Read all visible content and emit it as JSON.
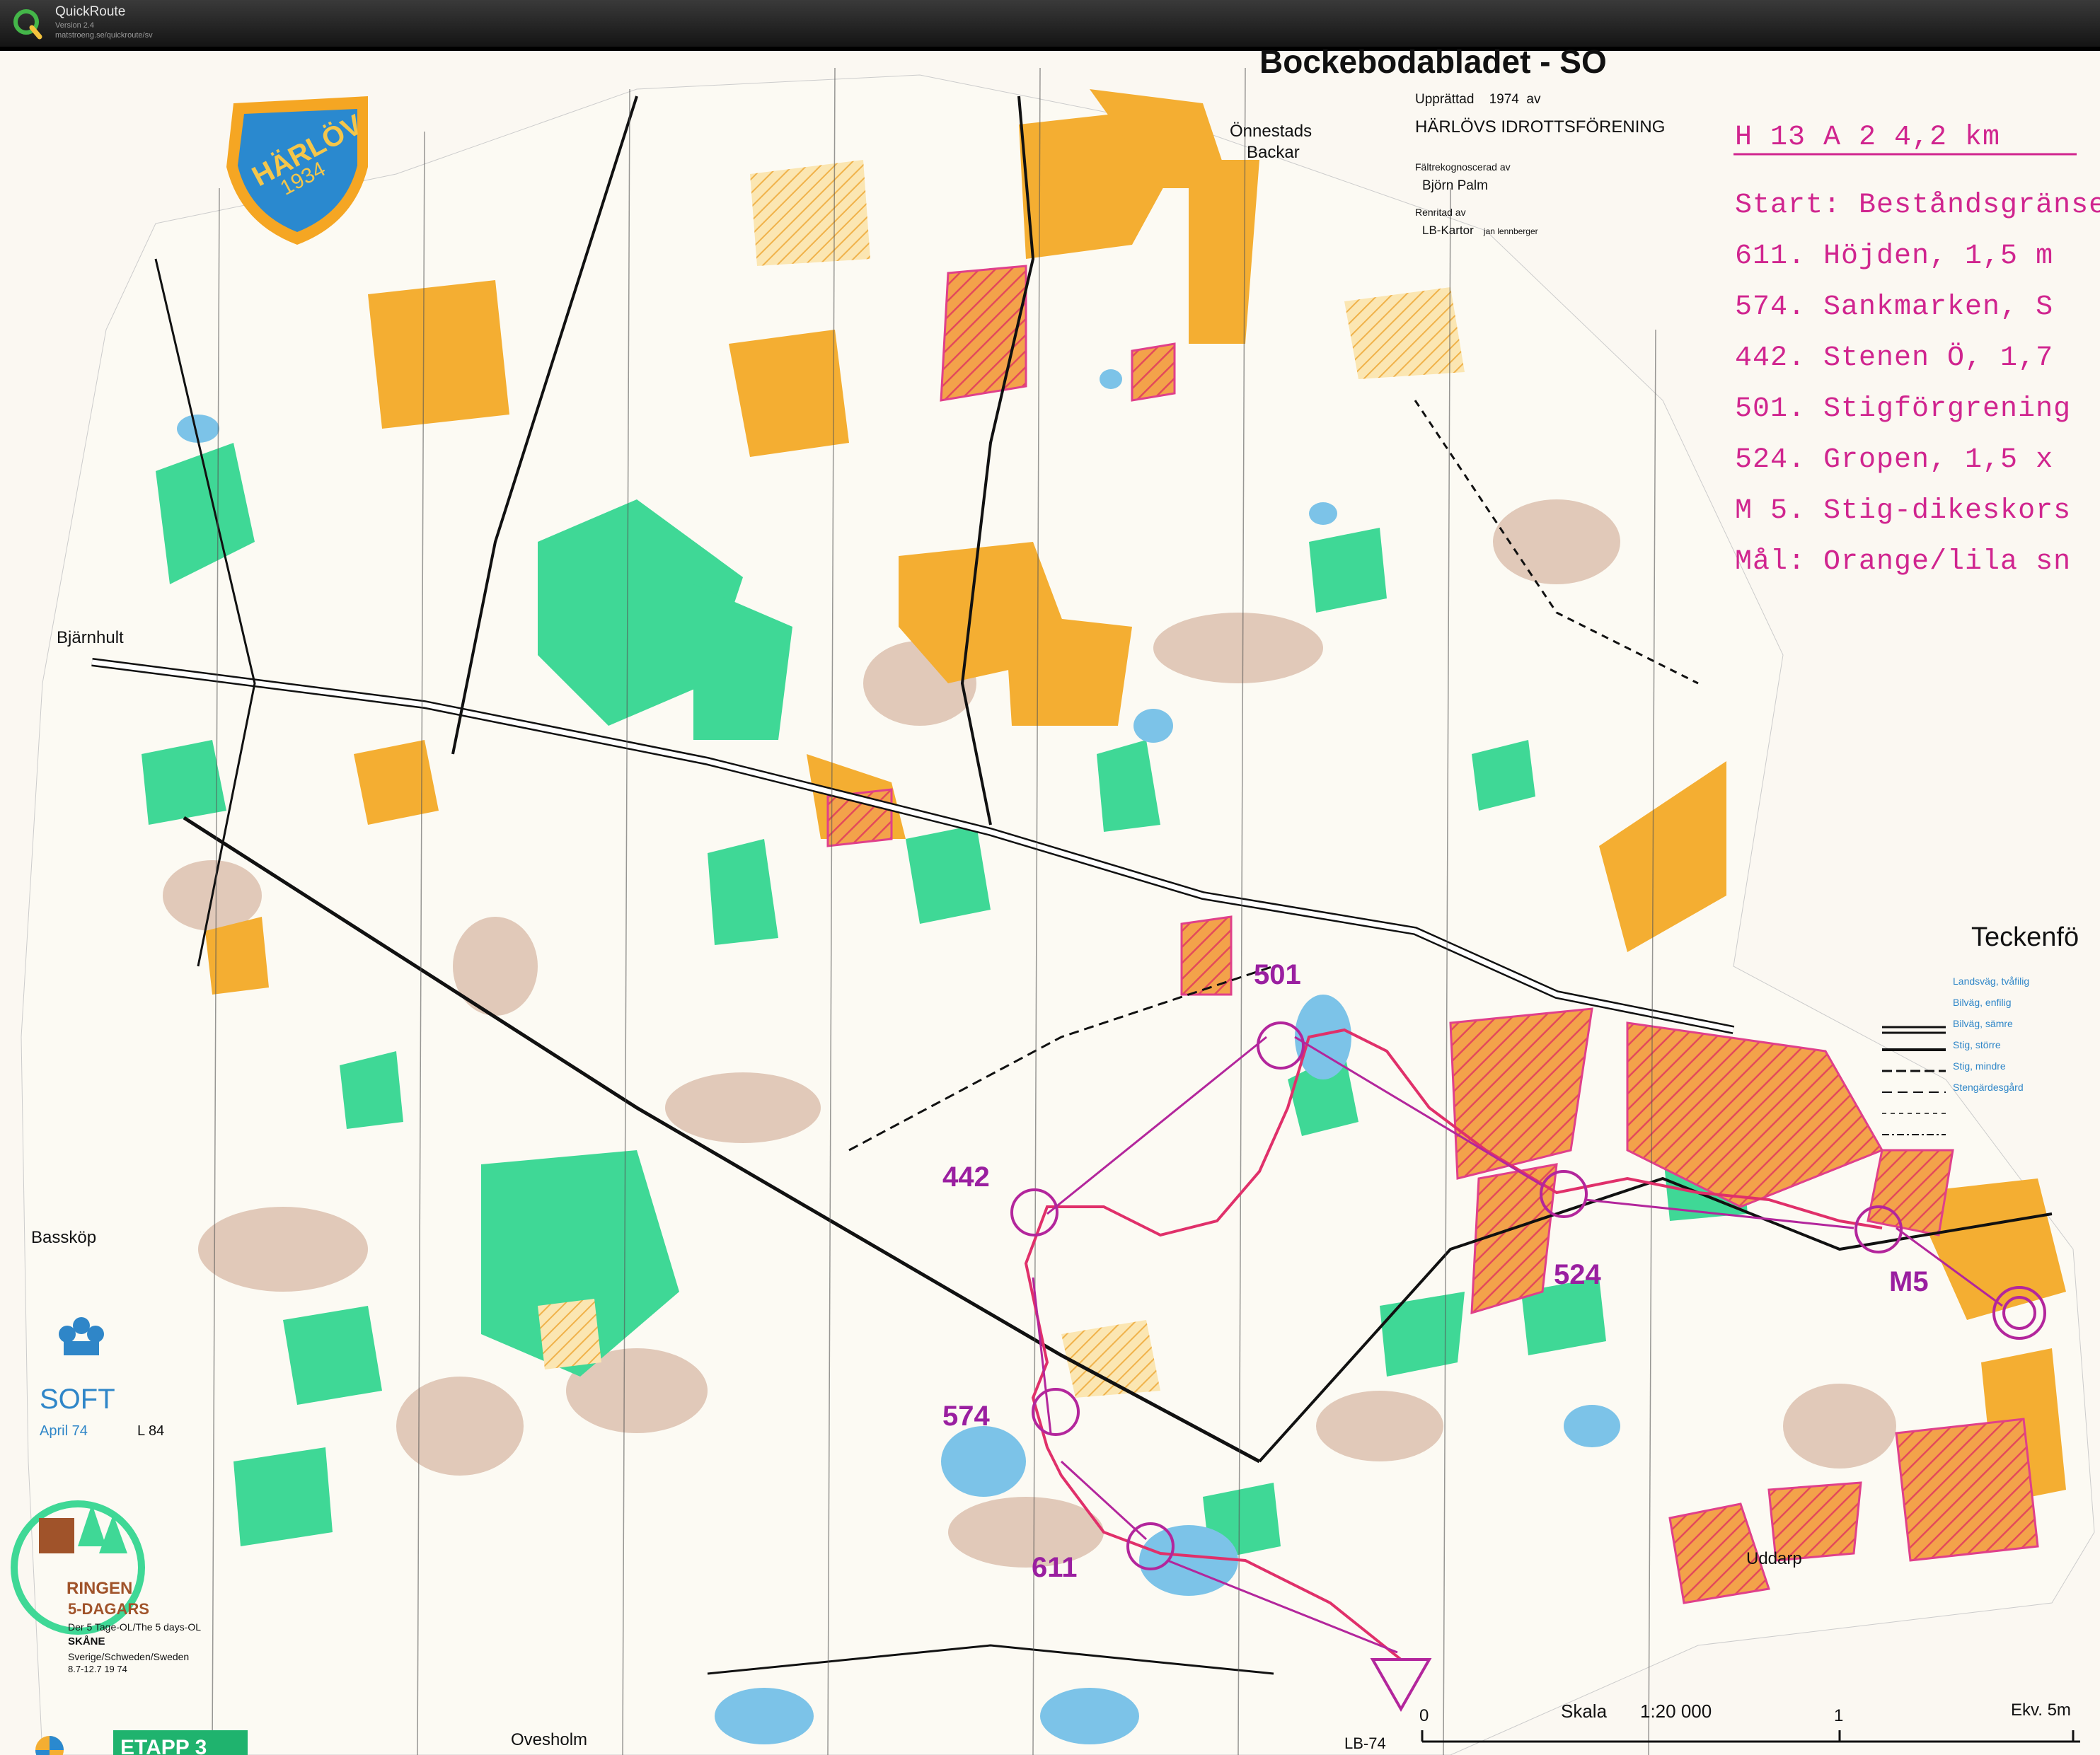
{
  "app": {
    "name": "QuickRoute",
    "version": "Version 2.4",
    "url": "matstroeng.se/quickroute/sv"
  },
  "map": {
    "title": "Bockebodabladet - SO",
    "credits": {
      "upprattad_label": "Upprättad",
      "year": "1974",
      "av": "av",
      "club": "HÄRLÖVS IDROTTSFÖRENING",
      "faltrek_label": "Fältrekognoscerad av",
      "faltrek_name": "Björn Palm",
      "renritad_label": "Renritad av",
      "renritad_name": "LB-Kartor",
      "renritad_person": "jan lennberger"
    },
    "club_logo": {
      "name": "HÄRLÖV",
      "year": "1934"
    },
    "course": {
      "header": "H 13 A 2     4,2 km",
      "lines": [
        "Start: Beståndsgränse",
        "611.   Höjden, 1,5 m",
        "574.   Sankmarken, S",
        "442.   Stenen Ö, 1,7",
        "501.   Stigförgrening",
        "524.   Gropen, 1,5 x",
        "M 5.   Stig-dikeskors",
        "Mål:   Orange/lila sn"
      ]
    },
    "places": {
      "onnestads": "Önnestads",
      "backar": "Backar",
      "bjarnhult": "Bjärnhult",
      "basskop": "Bassköp",
      "uddarp": "Uddarp",
      "ovesholm": "Ovesholm",
      "lb74": "LB-74"
    },
    "controls": [
      "501",
      "442",
      "524",
      "M5",
      "574",
      "611"
    ],
    "legend": {
      "title": "Teckenfö",
      "items": [
        "Landsväg, tvåfilig",
        "Bilväg, enfilig",
        "Bilväg, sämre",
        "Stig, större",
        "Stig, mindre",
        "Stengärdesgård"
      ]
    },
    "soft": {
      "name": "SOFT",
      "date": "April 74",
      "code": "L 84"
    },
    "event": {
      "ringen": "RINGEN",
      "dagars": "5-DAGARS",
      "line1": "Der 5 Tage-OL/The 5 days-OL",
      "skane": "SKÅNE",
      "country": "Sverige/Schweden/Sweden",
      "dates": "8.7-12.7 19 74",
      "etapp": "ETAPP 3"
    },
    "scale": {
      "zero": "0",
      "label": "Skala",
      "ratio": "1:20 000",
      "one": "1",
      "ekv": "Ekv. 5m"
    },
    "colors": {
      "open": "#f4ae32",
      "forest": "#3fd896",
      "brown": "#d9b8a6",
      "water": "#7cc3e8",
      "course": "#b3269c",
      "route": "#e0306a",
      "cultivated": "#f2703e"
    }
  }
}
